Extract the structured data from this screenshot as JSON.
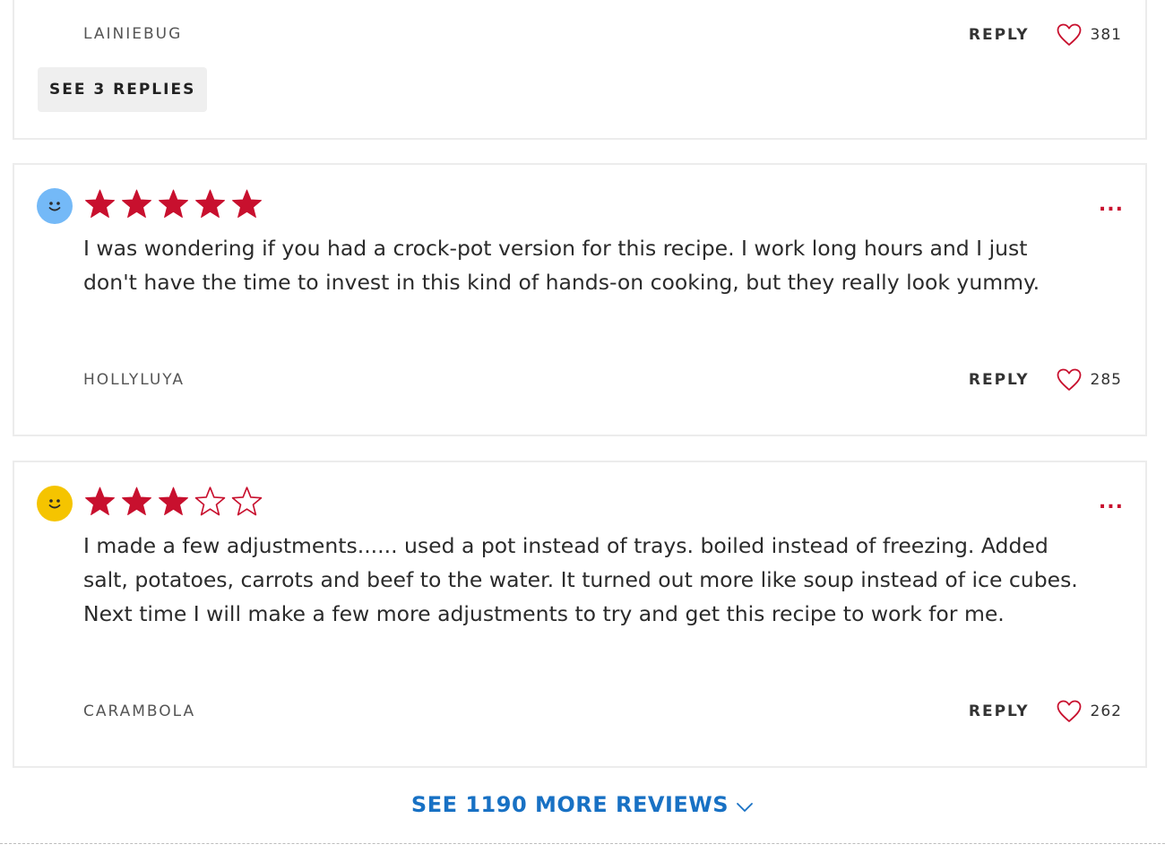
{
  "colors": {
    "accent": "#c8102e",
    "link": "#1871c4",
    "avatar_blue": "#74b9f7",
    "avatar_yellow": "#f5c400"
  },
  "top_review": {
    "author": "LAINIEBUG",
    "reply_label": "REPLY",
    "likes": "381",
    "see_replies_label": "SEE 3 REPLIES"
  },
  "reviews": [
    {
      "avatar_icon": "smiley-blue-icon",
      "rating": 5,
      "max_rating": 5,
      "more_label": "...",
      "text": "I was wondering if you had a crock-pot version for this recipe. I work long hours and I just don't have the time to invest in this kind of hands-on cooking, but they really look yummy.",
      "author": "HOLLYLUYA",
      "reply_label": "REPLY",
      "likes": "285"
    },
    {
      "avatar_icon": "smiley-yellow-icon",
      "rating": 3,
      "max_rating": 5,
      "more_label": "...",
      "text": "I made a few adjustments...... used a pot instead of trays. boiled instead of freezing. Added salt, potatoes, carrots and beef to the water. It turned out more like soup instead of ice cubes. Next time I will make a few more adjustments to try and get this recipe to work for me.",
      "author": "CARAMBOLA",
      "reply_label": "REPLY",
      "likes": "262"
    }
  ],
  "see_more_label": "SEE 1190 MORE REVIEWS"
}
